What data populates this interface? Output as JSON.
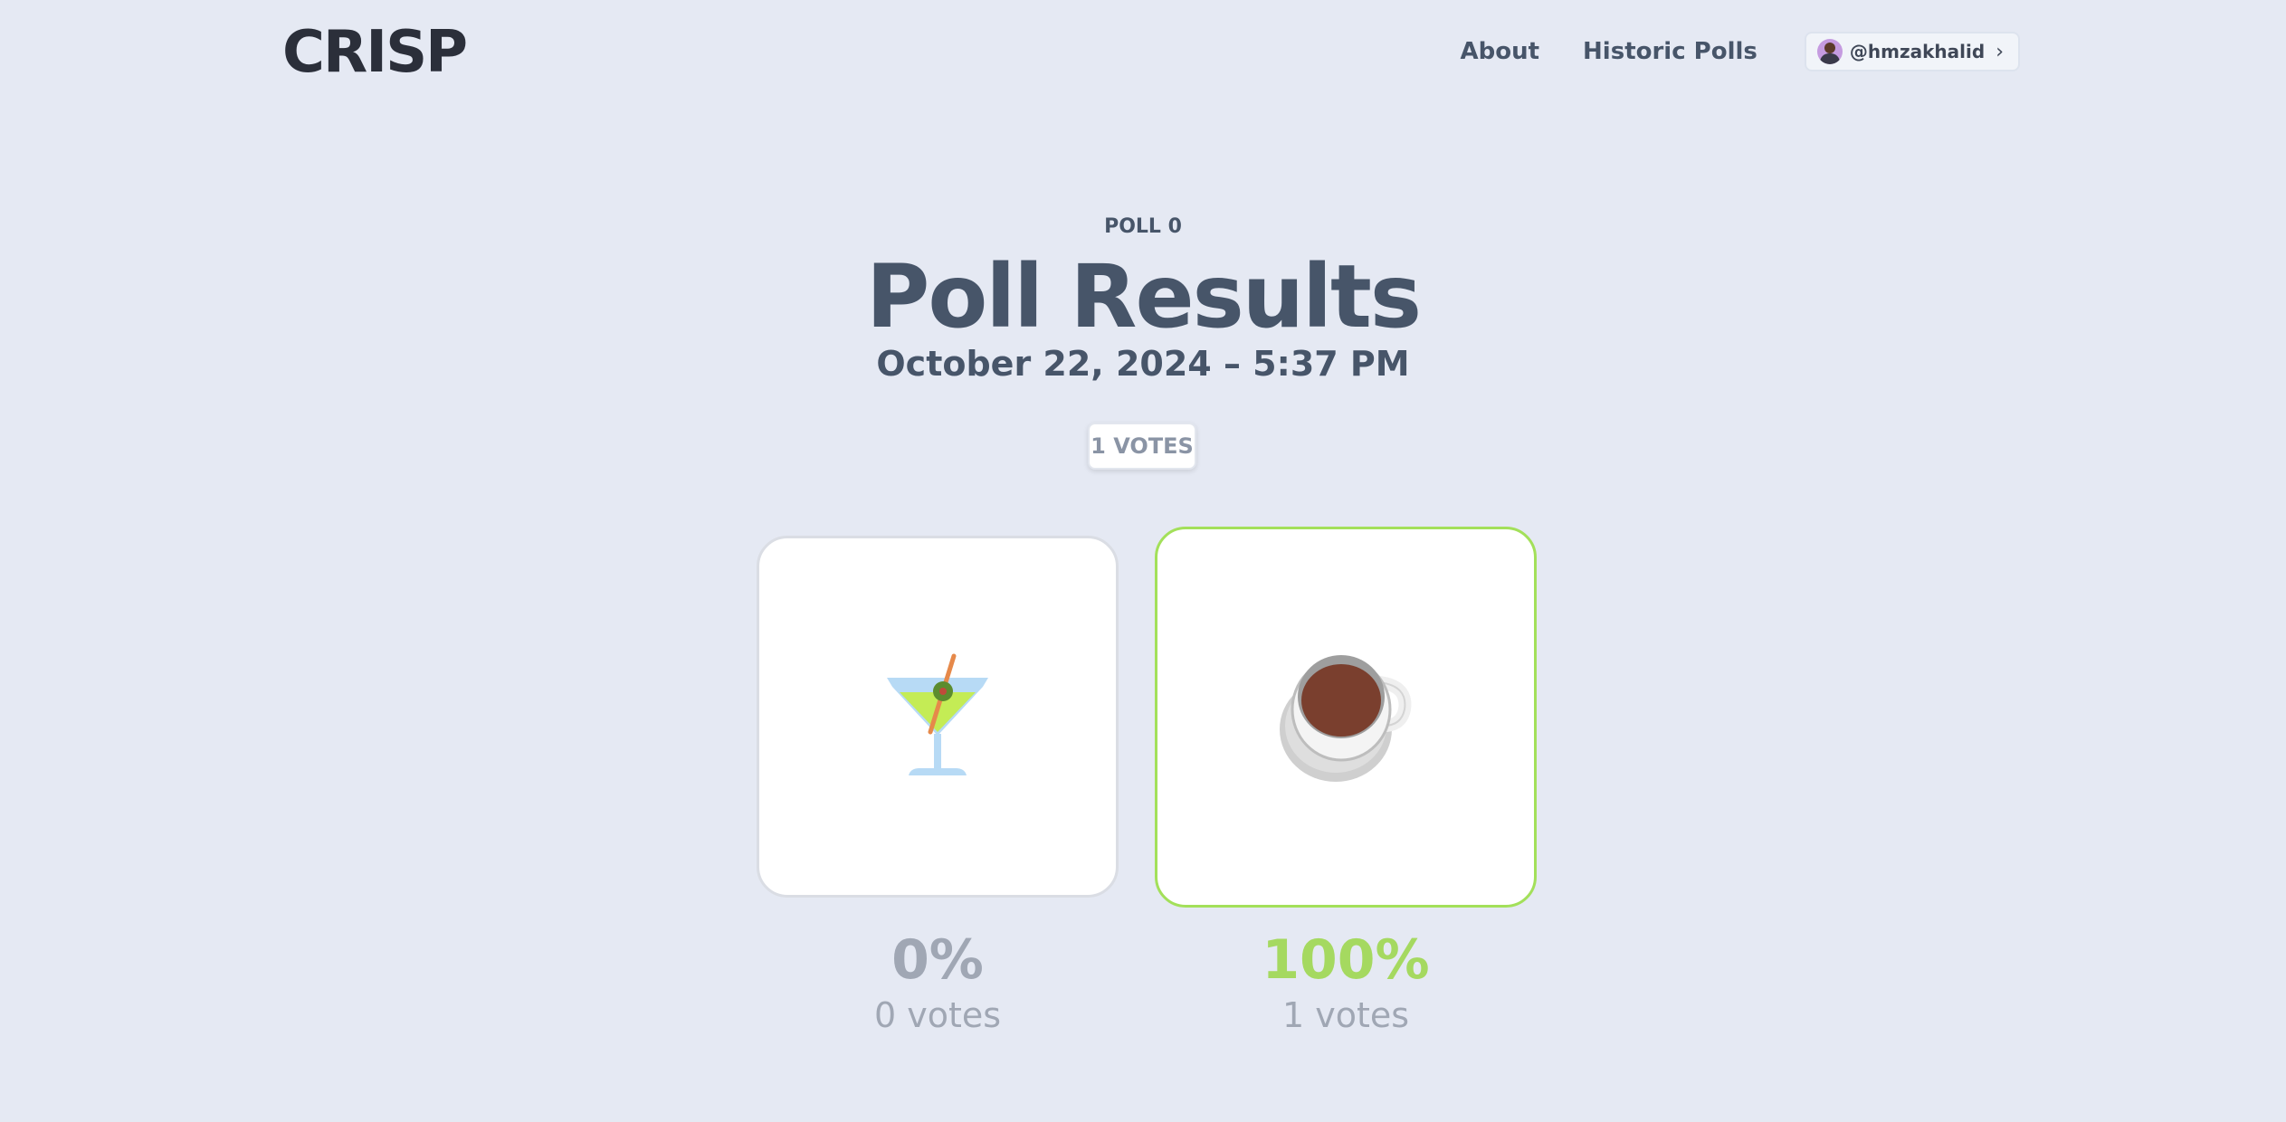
{
  "header": {
    "logo": "CRISP",
    "nav": {
      "about": "About",
      "historic": "Historic Polls"
    },
    "user": {
      "handle": "@hmzakhalid"
    }
  },
  "poll": {
    "eyebrow": "POLL 0",
    "title": "Poll Results",
    "datetime": "October 22, 2024 – 5:37 PM",
    "total_votes": "1 VOTES",
    "options": [
      {
        "icon": "cocktail-glass-icon",
        "percent": "0%",
        "votes": "0 votes",
        "winner": false
      },
      {
        "icon": "coffee-cup-icon",
        "percent": "100%",
        "votes": "1 votes",
        "winner": true
      }
    ]
  },
  "colors": {
    "background": "#e5e9f3",
    "winner_accent": "#a5d960",
    "text": "#475569",
    "muted": "#a0a7b4"
  }
}
